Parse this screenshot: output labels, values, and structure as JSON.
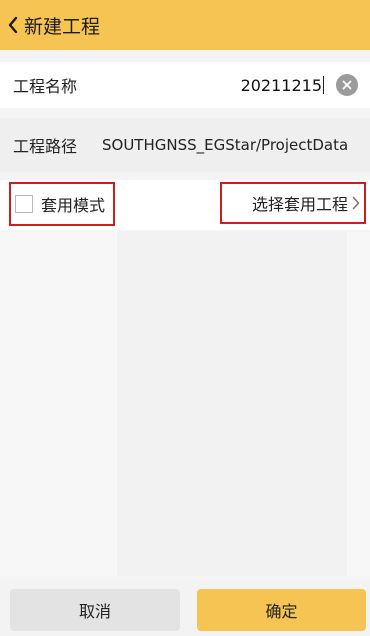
{
  "header": {
    "title": "新建工程",
    "back_icon": "chevron-left-icon"
  },
  "project_name": {
    "label": "工程名称",
    "value": "20211215",
    "clear_icon": "clear-circle-icon"
  },
  "project_path": {
    "label": "工程路径",
    "value": "SOUTHGNSS_EGStar/ProjectData"
  },
  "template_mode": {
    "label": "套用模式",
    "checked": false
  },
  "select_template": {
    "label": "选择套用工程",
    "chevron_icon": "chevron-right-icon"
  },
  "footer": {
    "cancel_label": "取消",
    "confirm_label": "确定"
  },
  "colors": {
    "header_bg": "#f6c453",
    "highlight_box": "#d01c1c",
    "confirm_bg": "#f6c453"
  }
}
